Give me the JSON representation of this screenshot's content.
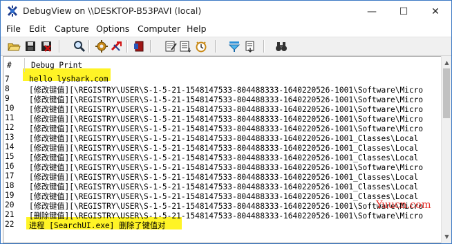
{
  "window": {
    "title": "DebugView on \\\\DESKTOP-B53PAVI (local)",
    "controls": {
      "minimize": "—",
      "maximize": "☐",
      "close": "✕"
    }
  },
  "menu": [
    "File",
    "Edit",
    "Capture",
    "Options",
    "Computer",
    "Help"
  ],
  "toolbar": {
    "icons": [
      "open-icon",
      "save-icon",
      "clear-icon",
      "find-icon",
      "capture-settings-icon",
      "capture-kernel-icon",
      "bookmark-icon",
      "edit-filter-icon",
      "history-depth-icon",
      "clock-icon",
      "highlight-filter-icon",
      "log-to-file-icon",
      "binoculars-icon"
    ]
  },
  "columns": {
    "num": "#",
    "text": "Debug Print"
  },
  "rows": [
    {
      "num": "7",
      "text": "hello lyshark.com"
    },
    {
      "num": "8",
      "text": "[修改键值][\\REGISTRY\\USER\\S-1-5-21-1548147533-804488333-1640220526-1001\\Software\\Micro"
    },
    {
      "num": "9",
      "text": "[修改键值][\\REGISTRY\\USER\\S-1-5-21-1548147533-804488333-1640220526-1001\\Software\\Micro"
    },
    {
      "num": "10",
      "text": "[修改键值][\\REGISTRY\\USER\\S-1-5-21-1548147533-804488333-1640220526-1001\\Software\\Micro"
    },
    {
      "num": "11",
      "text": "[修改键值][\\REGISTRY\\USER\\S-1-5-21-1548147533-804488333-1640220526-1001\\Software\\Micro"
    },
    {
      "num": "12",
      "text": "[修改键值][\\REGISTRY\\USER\\S-1-5-21-1548147533-804488333-1640220526-1001\\Software\\Micro"
    },
    {
      "num": "13",
      "text": "[修改键值][\\REGISTRY\\USER\\S-1-5-21-1548147533-804488333-1640220526-1001_Classes\\Local"
    },
    {
      "num": "14",
      "text": "[修改键值][\\REGISTRY\\USER\\S-1-5-21-1548147533-804488333-1640220526-1001_Classes\\Local"
    },
    {
      "num": "15",
      "text": "[修改键值][\\REGISTRY\\USER\\S-1-5-21-1548147533-804488333-1640220526-1001_Classes\\Local"
    },
    {
      "num": "16",
      "text": "[修改键值][\\REGISTRY\\USER\\S-1-5-21-1548147533-804488333-1640220526-1001\\Software\\Micro"
    },
    {
      "num": "17",
      "text": "[修改键值][\\REGISTRY\\USER\\S-1-5-21-1548147533-804488333-1640220526-1001_Classes\\Local"
    },
    {
      "num": "18",
      "text": "[修改键值][\\REGISTRY\\USER\\S-1-5-21-1548147533-804488333-1640220526-1001_Classes\\Local"
    },
    {
      "num": "19",
      "text": "[修改键值][\\REGISTRY\\USER\\S-1-5-21-1548147533-804488333-1640220526-1001_Classes\\Local"
    },
    {
      "num": "20",
      "text": "[修改键值][\\REGISTRY\\USER\\S-1-5-21-1548147533-804488333-1640220526-1001\\Software\\Micro"
    },
    {
      "num": "21",
      "text": "[删除键值][\\REGISTRY\\USER\\S-1-5-21-1548147533-804488333-1640220526-1001\\Software\\Micro"
    },
    {
      "num": "22",
      "text": "进程 [SearchUI.exe] 删除了键值对"
    }
  ],
  "watermark": "Yuucn.com",
  "colors": {
    "highlight": "#fff200",
    "watermark": "#e6302a",
    "window_border": "#3a78c4"
  }
}
